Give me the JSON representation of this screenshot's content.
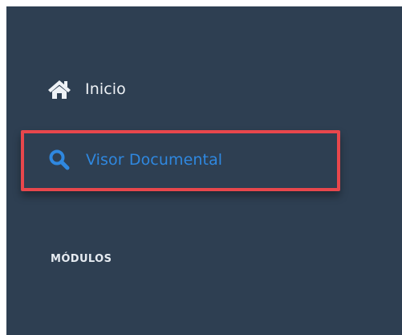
{
  "nav": {
    "items": [
      {
        "label": "Inicio",
        "icon": "home-icon"
      },
      {
        "label": "Visor Documental",
        "icon": "search-icon"
      }
    ],
    "section_title": "MÓDULOS"
  },
  "colors": {
    "panel_background": "#2e3f52",
    "text_light": "#eef2f6",
    "accent": "#2f88e0",
    "highlight": "#e8474c"
  }
}
